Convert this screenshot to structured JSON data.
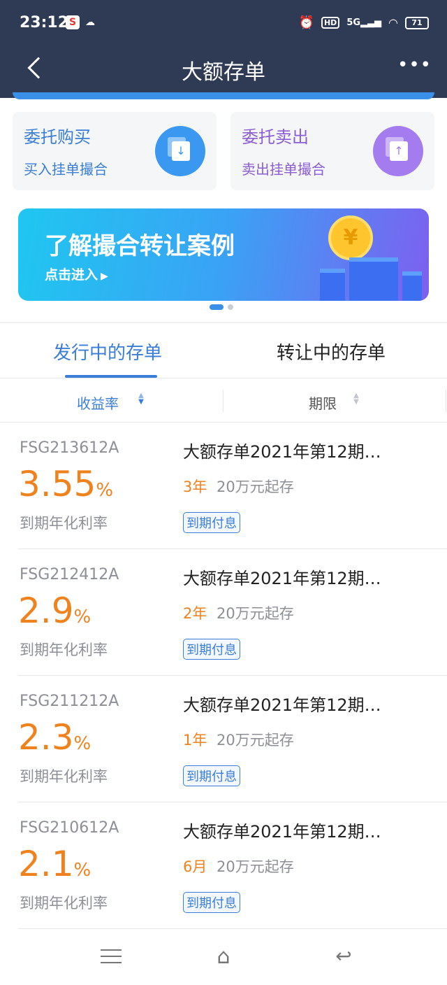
{
  "status_bar": {
    "time": "23:12",
    "app_badge": "S",
    "network": "5G",
    "hd": "HD",
    "battery": "71"
  },
  "nav": {
    "title": "大额存单"
  },
  "actions": {
    "buy": {
      "title": "委托购买",
      "subtitle": "买入挂单撮合",
      "icon": "download-doc-icon"
    },
    "sell": {
      "title": "委托卖出",
      "subtitle": "卖出挂单撮合",
      "icon": "upload-doc-icon"
    }
  },
  "banner": {
    "title": "了解撮合转让案例",
    "cta": "点击进入",
    "coin_symbol": "¥",
    "page_index": 1,
    "page_count": 2
  },
  "tabs": [
    {
      "label": "发行中的存单",
      "active": true
    },
    {
      "label": "转让中的存单",
      "active": false
    }
  ],
  "sort": {
    "yield_label": "收益率",
    "term_label": "期限"
  },
  "products": [
    {
      "code": "FSG213612A",
      "rate": "3.55",
      "pct": "%",
      "rate_label": "到期年化利率",
      "name": "大额存单2021年第12期…",
      "term": "3年",
      "min": "20万元起存",
      "tag": "到期付息"
    },
    {
      "code": "FSG212412A",
      "rate": "2.9",
      "pct": "%",
      "rate_label": "到期年化利率",
      "name": "大额存单2021年第12期…",
      "term": "2年",
      "min": "20万元起存",
      "tag": "到期付息"
    },
    {
      "code": "FSG211212A",
      "rate": "2.3",
      "pct": "%",
      "rate_label": "到期年化利率",
      "name": "大额存单2021年第12期…",
      "term": "1年",
      "min": "20万元起存",
      "tag": "到期付息"
    },
    {
      "code": "FSG210612A",
      "rate": "2.1",
      "pct": "%",
      "rate_label": "到期年化利率",
      "name": "大额存单2021年第12期…",
      "term": "6月",
      "min": "20万元起存",
      "tag": "到期付息"
    }
  ],
  "colors": {
    "header_bg": "#2f3a55",
    "accent_blue": "#3a7ed8",
    "rate_orange": "#f0821e",
    "sell_purple": "#8a5cd6"
  }
}
